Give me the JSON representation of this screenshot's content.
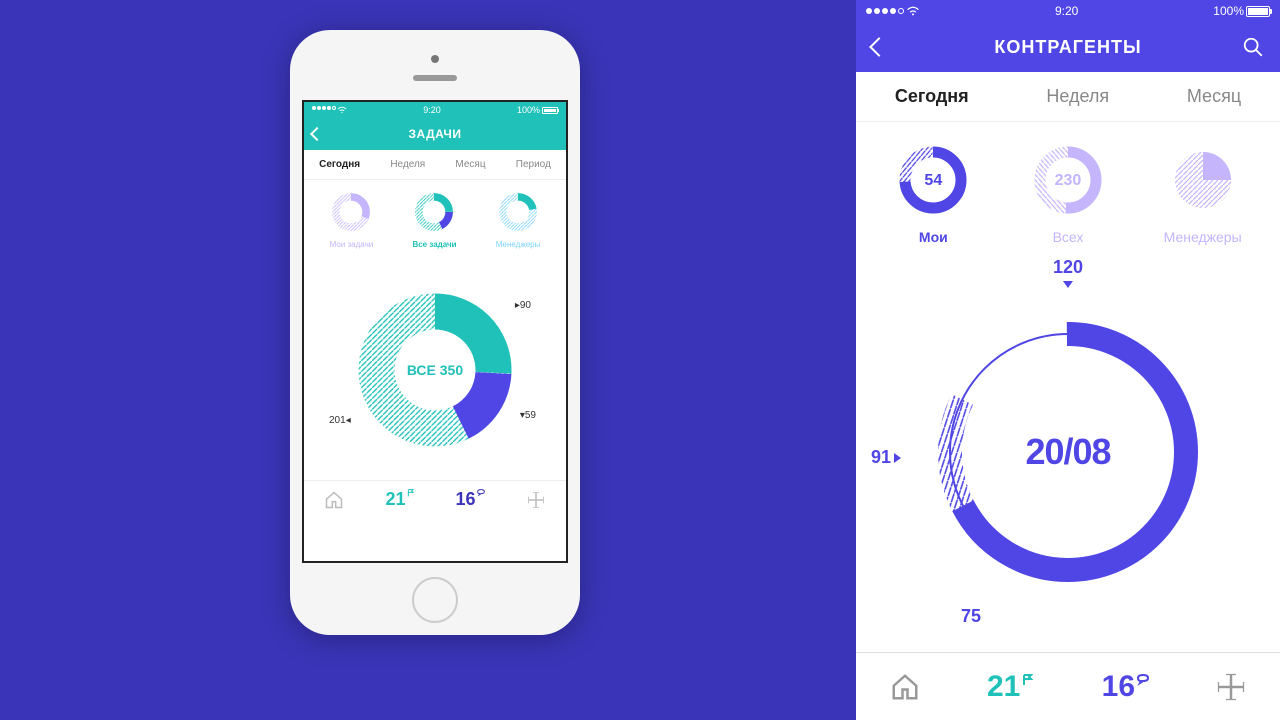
{
  "left_phone": {
    "status": {
      "time": "9:20",
      "battery": "100%"
    },
    "header": {
      "title": "ЗАДАЧИ"
    },
    "tabs": [
      "Сегодня",
      "Неделя",
      "Месяц",
      "Период"
    ],
    "active_tab": 0,
    "mini_donuts": [
      {
        "label": "Мои задачи",
        "color": "#c4b5fd"
      },
      {
        "label": "Все задачи",
        "color": "#1fc1b8"
      },
      {
        "label": "Менеджеры",
        "color": "#7dd3fc"
      }
    ],
    "active_mini": 1,
    "big_donut": {
      "center_label": "ВСЕ 350",
      "segments": [
        {
          "value": 90,
          "label": "90"
        },
        {
          "value": 59,
          "label": "59"
        },
        {
          "value": 201,
          "label": "201"
        }
      ]
    },
    "bottom_nav": {
      "flags": "21",
      "comments": "16"
    }
  },
  "right_screen": {
    "status": {
      "time": "9:20",
      "battery": "100%"
    },
    "header": {
      "title": "КОНТРАГЕНТЫ"
    },
    "tabs": [
      "Сегодня",
      "Неделя",
      "Месяц"
    ],
    "active_tab": 0,
    "mini_donuts": [
      {
        "label": "Мои",
        "value": "54"
      },
      {
        "label": "Всех",
        "value": "230"
      },
      {
        "label": "Менеджеры",
        "value": ""
      }
    ],
    "active_mini": 0,
    "big_donut": {
      "center_label": "20/08",
      "top_label": "120",
      "left_label": "91",
      "bottom_label": "75"
    },
    "bottom_nav": {
      "flags": "21",
      "comments": "16"
    }
  },
  "chart_data": [
    {
      "type": "pie",
      "title": "ВСЕ 350",
      "series": [
        {
          "name": "segment-teal-solid",
          "value": 90
        },
        {
          "name": "segment-indigo",
          "value": 59
        },
        {
          "name": "segment-teal-hatched",
          "value": 201
        }
      ]
    },
    {
      "type": "pie",
      "title": "20/08",
      "series": [
        {
          "name": "solid-arc",
          "value": 120
        },
        {
          "name": "hatched-arc",
          "value": 91
        },
        {
          "name": "remainder",
          "value": 75
        }
      ]
    }
  ]
}
